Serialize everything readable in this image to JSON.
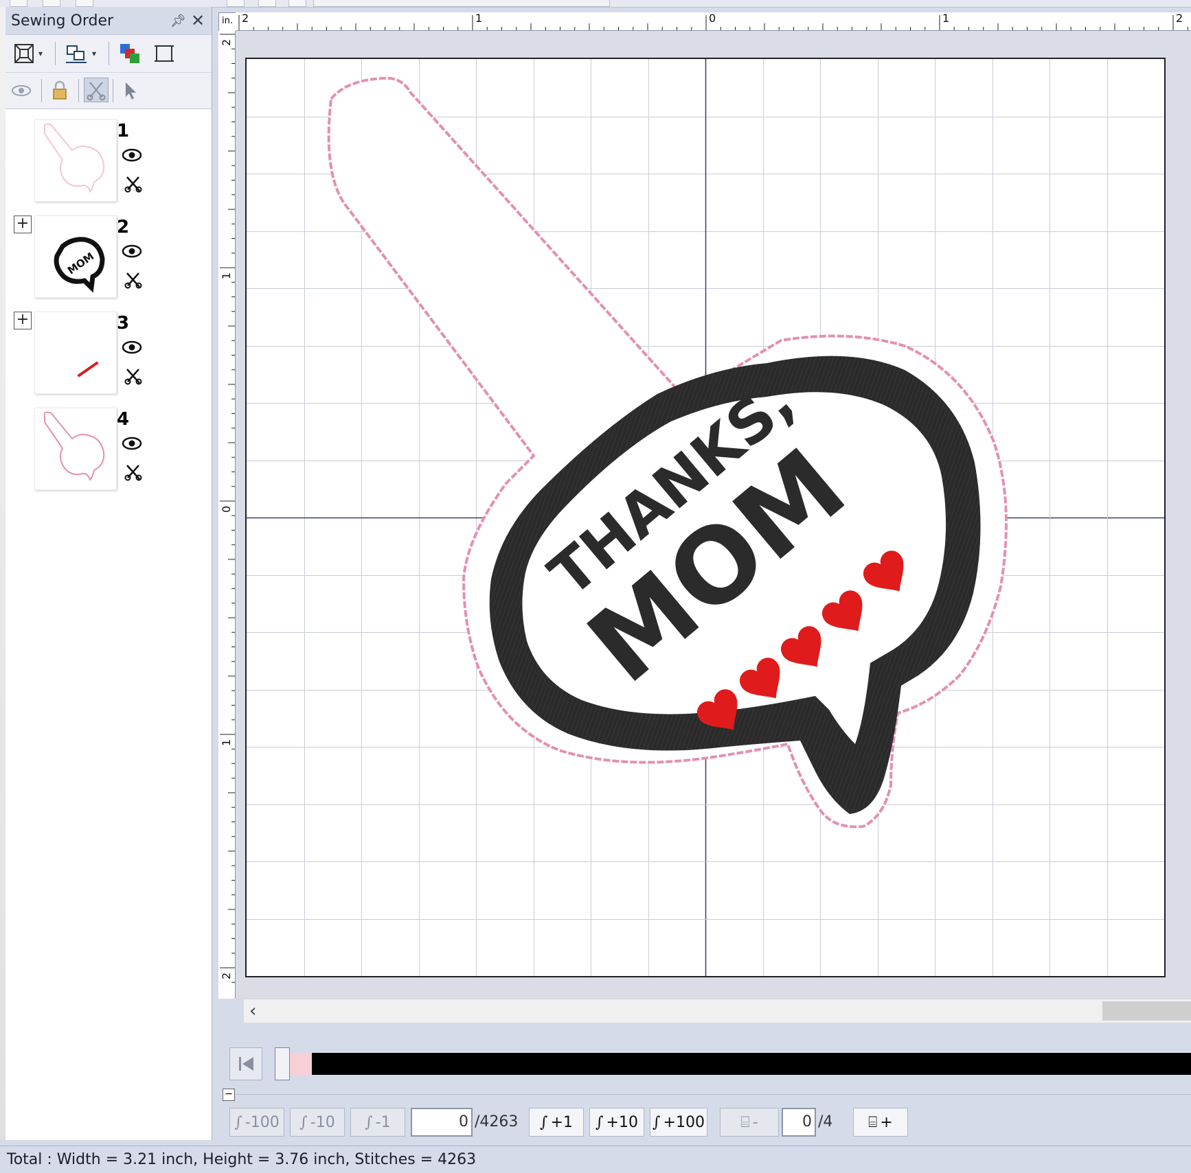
{
  "panel": {
    "title": "Sewing Order",
    "items": [
      {
        "number": "1"
      },
      {
        "number": "2"
      },
      {
        "number": "3"
      },
      {
        "number": "4"
      }
    ]
  },
  "ruler": {
    "corner": "in.",
    "h_labels": [
      "2",
      "1",
      "0",
      "1",
      "2"
    ],
    "v_labels": [
      "2",
      "1",
      "0",
      "1",
      "2"
    ]
  },
  "design": {
    "line1": "THANKS,",
    "line2": "MOM",
    "colors": {
      "outline": "#e48fb3",
      "satin": "#2b2b2b",
      "hearts": "#e01b1b",
      "fabric": "#ffffff"
    }
  },
  "simulator": {
    "minus100": "-100",
    "minus10": "-10",
    "minus1": "-1",
    "stitch_value": "0",
    "stitch_total": "/4263",
    "plus1": "+1",
    "plus10": "+10",
    "plus100": "+100",
    "color_minus": "-",
    "color_value": "0",
    "color_total": "/4",
    "color_plus": "+",
    "progress_fraction": 0
  },
  "status": {
    "text": "Total : Width = 3.21 inch, Height = 3.76 inch, Stitches = 4263"
  }
}
